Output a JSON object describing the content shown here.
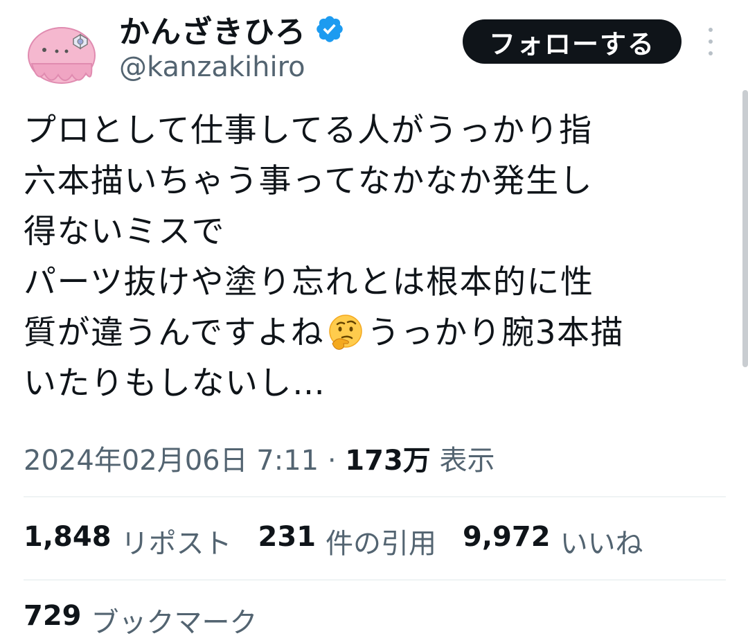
{
  "user": {
    "display_name": "かんざきひろ",
    "handle": "@kanzakihiro"
  },
  "follow_button_label": "フォローする",
  "tweet": {
    "lines": [
      "プロとして仕事してる人がうっかり指",
      "六本描いちゃう事ってなかなか発生し",
      "得ないミスで",
      "パーツ抜けや塗り忘れとは根本的に性",
      "いたりもしないし…"
    ],
    "line5_before_emoji": "質が違うんですよね",
    "line5_after_emoji": "うっかり腕3本描"
  },
  "meta": {
    "date_time": "2024年02月06日 7:11",
    "separator": " · ",
    "views_count": "173万",
    "views_label": "表示"
  },
  "stats": {
    "reposts_count": "1,848",
    "reposts_label": "リポスト",
    "quotes_count": "231",
    "quotes_label": "件の引用",
    "likes_count": "9,972",
    "likes_label": "いいね",
    "bookmarks_count": "729",
    "bookmarks_label": "ブックマーク"
  },
  "icons": {
    "verified": "verified-badge-icon",
    "more": "more-vertical-icon",
    "emoji": "thinking-face-emoji"
  },
  "colors": {
    "text": "#0f1419",
    "secondary": "#536471",
    "verified": "#1d9bf0",
    "button": "#0f1419",
    "divider": "#eff3f4"
  }
}
